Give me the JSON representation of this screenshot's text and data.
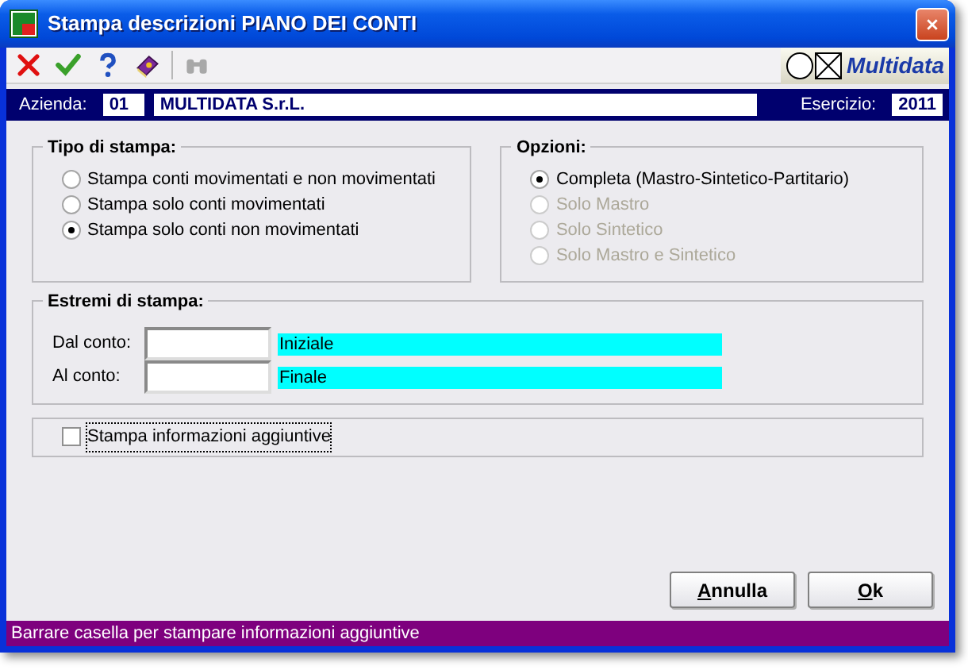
{
  "window": {
    "title": "Stampa descrizioni PIANO DEI CONTI"
  },
  "toolbar": [
    {
      "kind": "cancel",
      "disabled": false
    },
    {
      "kind": "confirm",
      "disabled": false
    },
    {
      "kind": "help",
      "disabled": false
    },
    {
      "kind": "book",
      "disabled": false
    },
    {
      "kind": "binoculars",
      "disabled": true
    }
  ],
  "logo": {
    "text": "Multidata"
  },
  "header": {
    "company_label": "Azienda:",
    "company_code": "01",
    "company_name": "MULTIDATA S.r.L.",
    "year_label": "Esercizio:",
    "year": "2011"
  },
  "print_type": {
    "title": "Tipo di stampa:",
    "options": [
      {
        "label": "Stampa conti movimentati e non movimentati",
        "selected": false,
        "disabled": false
      },
      {
        "label": "Stampa solo conti movimentati",
        "selected": false,
        "disabled": false
      },
      {
        "label": "Stampa solo conti non movimentati",
        "selected": true,
        "disabled": false
      }
    ]
  },
  "options": {
    "title": "Opzioni:",
    "options": [
      {
        "label": "Completa (Mastro-Sintetico-Partitario)",
        "selected": true,
        "disabled": false
      },
      {
        "label": "Solo Mastro",
        "selected": false,
        "disabled": true
      },
      {
        "label": "Solo Sintetico",
        "selected": false,
        "disabled": true
      },
      {
        "label": "Solo Mastro e Sintetico",
        "selected": false,
        "disabled": true
      }
    ]
  },
  "range": {
    "title": "Estremi di stampa:",
    "rows": [
      {
        "label": "Dal conto:",
        "description": "Iniziale"
      },
      {
        "label": "Al conto:",
        "description": "Finale"
      }
    ]
  },
  "extra": {
    "label": "Stampa informazioni aggiuntive",
    "checked": false,
    "focused": true
  },
  "buttons": [
    {
      "label": "Annulla"
    },
    {
      "label": "Ok"
    }
  ],
  "status_bar": "Barrare casella per stampare informazioni aggiuntive"
}
